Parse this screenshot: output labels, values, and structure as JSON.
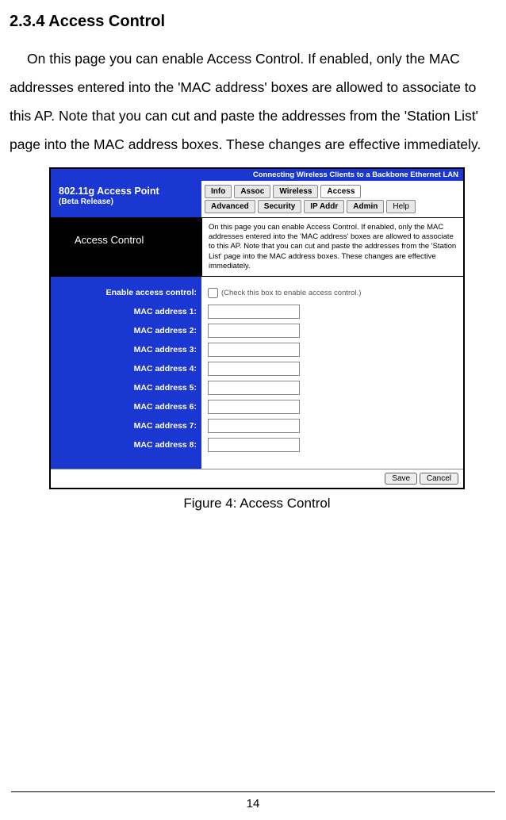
{
  "doc": {
    "heading": "2.3.4  Access Control",
    "intro": "On this page you can enable Access Control. If enabled, only the MAC addresses entered into the 'MAC address' boxes are allowed to associate to this AP. Note that you can cut and paste the addresses from the 'Station List' page into the MAC address boxes. These changes are effective immediately.",
    "caption": "Figure 4: Access Control",
    "page_number": "14"
  },
  "ap": {
    "top_banner": "Connecting Wireless Clients to a Backbone Ethernet LAN",
    "title": "802.11g Access Point",
    "beta": "(Beta Release)",
    "tabs_row1": [
      "Info",
      "Assoc",
      "Wireless",
      "Access"
    ],
    "tabs_row2": [
      "Advanced",
      "Security",
      "IP Addr",
      "Admin",
      "Help"
    ],
    "section_title": "Access Control",
    "section_desc": "On this page you can enable Access Control. If enabled, only the MAC addresses entered into the 'MAC address' boxes are allowed to associate to this AP. Note that you can cut and paste the addresses from the 'Station List' page into the MAC address boxes. These changes are effective immediately.",
    "labels": {
      "enable": "Enable access control:",
      "mac1": "MAC address 1:",
      "mac2": "MAC address 2:",
      "mac3": "MAC address 3:",
      "mac4": "MAC address 4:",
      "mac5": "MAC address 5:",
      "mac6": "MAC address 6:",
      "mac7": "MAC address 7:",
      "mac8": "MAC address 8:"
    },
    "hint": "(Check this box to enable access control.)",
    "inputs": {
      "enable_checked": false,
      "mac1": "",
      "mac2": "",
      "mac3": "",
      "mac4": "",
      "mac5": "",
      "mac6": "",
      "mac7": "",
      "mac8": ""
    },
    "buttons": {
      "save": "Save",
      "cancel": "Cancel"
    }
  }
}
